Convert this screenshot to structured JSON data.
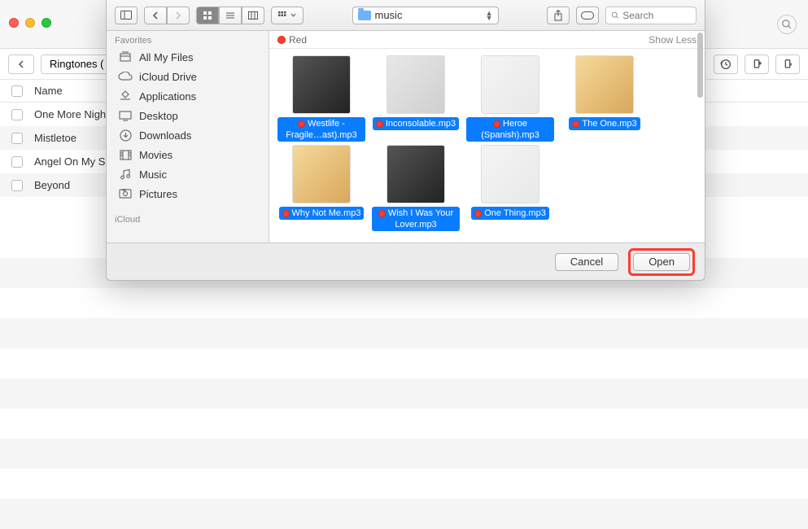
{
  "bg": {
    "tab_label": "Ringtones (",
    "table": {
      "name_header": "Name"
    },
    "rows": [
      "One More Nigh",
      "Mistletoe",
      "Angel On My S",
      "Beyond"
    ]
  },
  "dialog": {
    "folder": "music",
    "search_placeholder": "Search",
    "tag_label": "Red",
    "show_less": "Show Less",
    "cancel": "Cancel",
    "open": "Open"
  },
  "sidebar": {
    "favorites_label": "Favorites",
    "items": [
      {
        "label": "All My Files"
      },
      {
        "label": "iCloud Drive"
      },
      {
        "label": "Applications"
      },
      {
        "label": "Desktop"
      },
      {
        "label": "Downloads"
      },
      {
        "label": "Movies"
      },
      {
        "label": "Music"
      },
      {
        "label": "Pictures"
      }
    ],
    "icloud_label": "iCloud"
  },
  "files": [
    {
      "label": "Westlife - Fragile…ast).mp3"
    },
    {
      "label": "Inconsolable.mp3"
    },
    {
      "label": "Heroe (Spanish).mp3"
    },
    {
      "label": "The One.mp3"
    },
    {
      "label": "Why Not Me.mp3"
    },
    {
      "label": "Wish I Was Your Lover.mp3"
    },
    {
      "label": "One Thing.mp3"
    }
  ]
}
